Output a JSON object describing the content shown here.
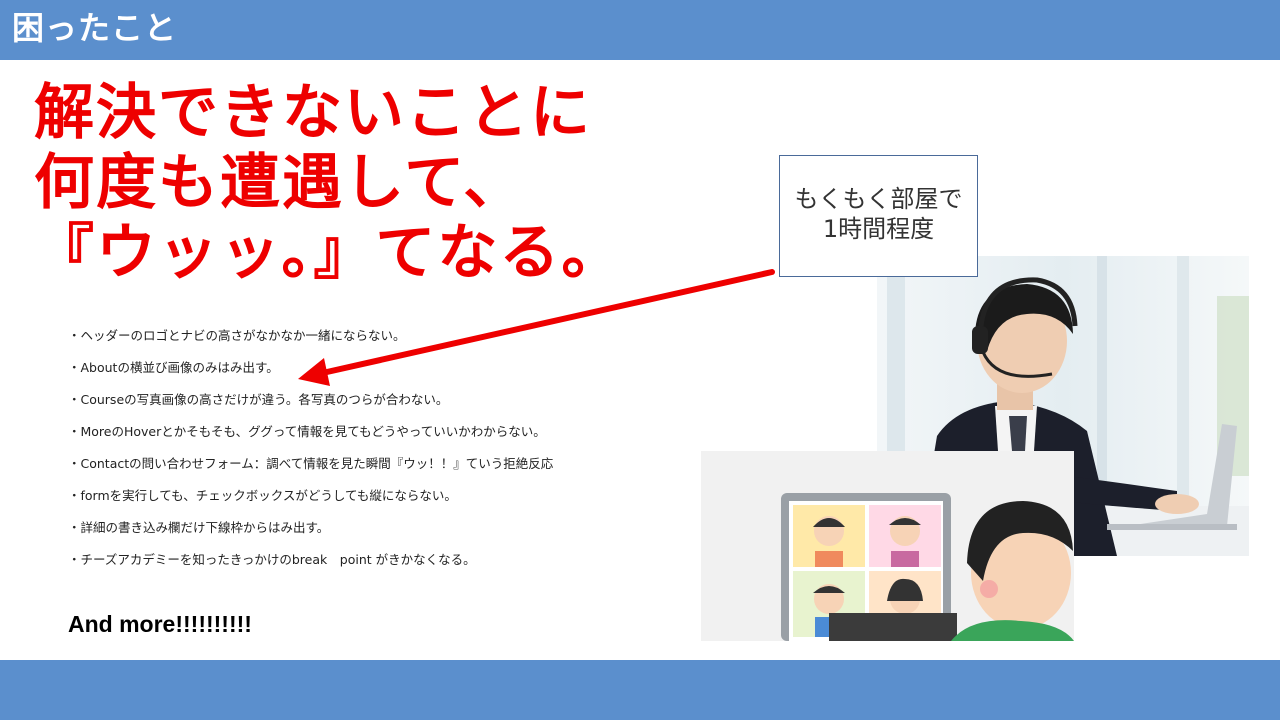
{
  "slide": {
    "title": "困ったこと",
    "headline": [
      "解決できないことに",
      "何度も遭遇して、",
      "『ウッッ。』てなる。"
    ],
    "issues": [
      "・ヘッダーのロゴとナビの高さがなかなか一緒にならない。",
      "・Aboutの横並び画像のみはみ出す。",
      "・Courseの写真画像の高さだけが違う。各写真のつらが合わない。",
      "・MoreのHoverとかそもそも、ググって情報を見てもどうやっていいかわからない。",
      "・Contactの問い合わせフォーム：調べて情報を見た瞬間『ウッ！！』ていう拒絶反応",
      "・formを実行しても、チェックボックスがどうしても縦にならない。",
      "・詳細の書き込み欄だけ下線枠からはみ出す。",
      "・チーズアカデミーを知ったきっかけのbreak　point がきかなくなる。"
    ],
    "more": "And more!!!!!!!!!!",
    "callout": [
      "もくもく部屋で",
      "1時間程度"
    ]
  },
  "images": {
    "office": "photo-student-headset-laptop",
    "meeting": "illustration-online-meeting"
  },
  "colors": {
    "bar": "#5b8fcd",
    "headline": "#ee0000",
    "arrow": "#ee0000"
  }
}
